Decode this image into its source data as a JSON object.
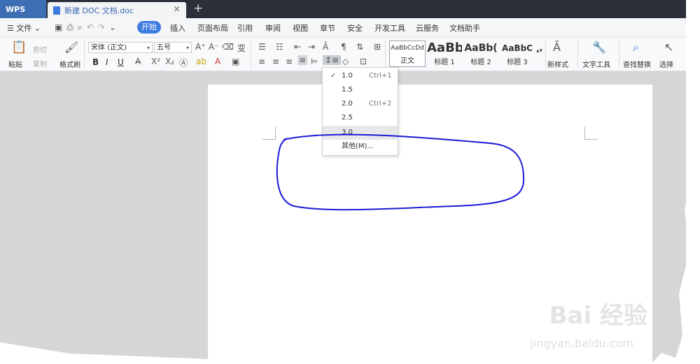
{
  "titlebar": {
    "app_tab": "WPS",
    "doc_tab": "新建 DOC 文档.doc",
    "close": "×",
    "new_tab": "+"
  },
  "menubar": {
    "file": "☰ 文件 ⌄",
    "items": [
      "开始",
      "插入",
      "页面布局",
      "引用",
      "审阅",
      "视图",
      "章节",
      "安全",
      "开发工具",
      "云服务",
      "文档助手"
    ]
  },
  "ribbon": {
    "paste": "粘贴",
    "cut": "剪切",
    "copy": "复制",
    "format_painter": "格式刷",
    "font_name": "宋体 (正文)",
    "font_size": "五号",
    "bold": "B",
    "italic": "I",
    "underline": "U",
    "styles": [
      {
        "sample": "AaBbCcDd",
        "label": "正文"
      },
      {
        "sample": "AaBb",
        "label": "标题 1"
      },
      {
        "sample": "AaBb(",
        "label": "标题 2"
      },
      {
        "sample": "AaBbC",
        "label": "标题 3"
      }
    ],
    "new_style": "新样式",
    "text_tools": "文字工具",
    "find_replace": "查找替换",
    "select": "选择"
  },
  "line_spacing_menu": {
    "items": [
      {
        "value": "1.0",
        "shortcut": "Ctrl+1",
        "checked": true
      },
      {
        "value": "1.5",
        "shortcut": ""
      },
      {
        "value": "2.0",
        "shortcut": "Ctrl+2"
      },
      {
        "value": "2.5",
        "shortcut": ""
      },
      {
        "value": "3.0",
        "shortcut": "",
        "hovered": true
      },
      {
        "value": "其他(M)...",
        "shortcut": ""
      }
    ]
  },
  "watermark": {
    "brand": "Bai 经验",
    "url": "jingyan.baidu.com"
  },
  "colors": {
    "accent": "#3e7be0",
    "annotation": "#1d1ad6"
  }
}
